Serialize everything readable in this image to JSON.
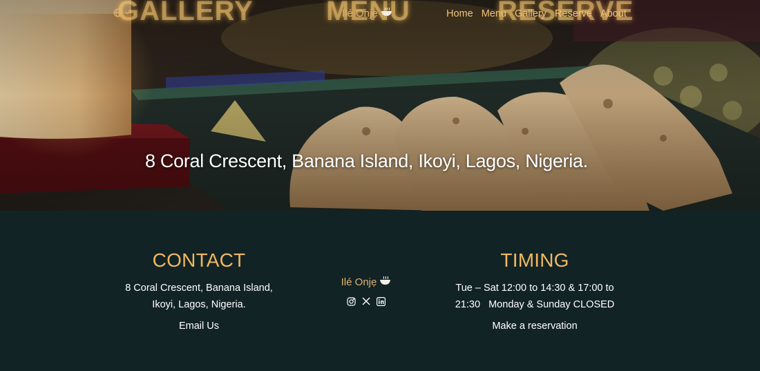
{
  "nav": {
    "brand_text": "Ilé Onjẹ",
    "brand_icon": "bowl-icon",
    "language_icon": "globe-icon",
    "links": [
      "Home",
      "Menu",
      "Gallery",
      "Reserve",
      "About"
    ]
  },
  "hero": {
    "background_words": [
      "GALLERY",
      "MENU",
      "RESERVE"
    ],
    "address": "8 Coral Crescent, Banana Island, Ikoyi, Lagos, Nigeria."
  },
  "footer": {
    "contact": {
      "heading": "CONTACT",
      "address_line1": "8 Coral Crescent, Banana Island,",
      "address_line2": "Ikoyi, Lagos, Nigeria.",
      "email_link": "Email Us"
    },
    "brand_text": "Ilé Onjẹ",
    "socials": [
      "instagram-icon",
      "x-icon",
      "linkedin-icon"
    ],
    "timing": {
      "heading": "TIMING",
      "line1": "Tue – Sat 12:00 to 14:30 & 17:00 to",
      "line2": "21:30   Monday & Sunday CLOSED",
      "reservation_link": "Make a reservation"
    }
  },
  "colors": {
    "accent": "#f0b860",
    "footer_bg": "#122326",
    "nav_link": "#f0c27a",
    "text": "#ffffff"
  }
}
